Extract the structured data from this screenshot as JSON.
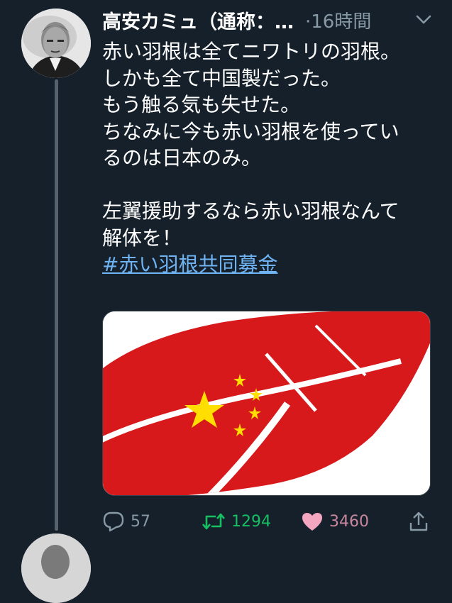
{
  "tweet": {
    "author_name": "高安カミュ（通称：…",
    "time": "·16時間",
    "lines": [
      "赤い羽根は全てニワトリの羽根。",
      "しかも全て中国製だった。",
      "もう触る気も失せた。",
      "ちなみに今も赤い羽根を使ってい",
      "るのは日本のみ。"
    ],
    "lines2": [
      "左翼援助するなら赤い羽根なんて",
      "解体を！"
    ],
    "hashtag": "#赤い羽根共同募金"
  },
  "actions": {
    "replies": "57",
    "retweets": "1294",
    "likes": "3460"
  },
  "colors": {
    "background": "#15202b",
    "retweet": "#17bf63",
    "like": "#e0245e",
    "like_fill": "#f4a6c1",
    "link": "#6fb3f2",
    "muted": "#8899a6"
  },
  "icons": [
    "reply-icon",
    "retweet-icon",
    "like-icon",
    "share-icon",
    "chevron-down-icon"
  ]
}
